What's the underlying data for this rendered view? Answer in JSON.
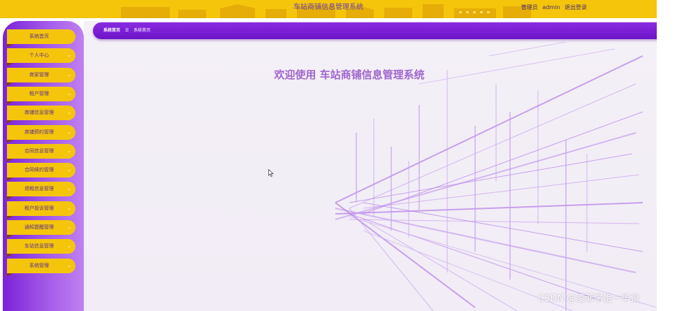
{
  "header": {
    "title": "车站商铺信息管理系统",
    "role": "管理员",
    "username": "admin",
    "logout_label": "退出登录"
  },
  "sidebar": {
    "items": [
      {
        "label": "系统首页",
        "has_submenu": false
      },
      {
        "label": "个人中心",
        "has_submenu": true
      },
      {
        "label": "商家管理",
        "has_submenu": true
      },
      {
        "label": "租户管理",
        "has_submenu": true
      },
      {
        "label": "商铺信息管理",
        "has_submenu": true
      },
      {
        "label": "商铺预约管理",
        "has_submenu": true
      },
      {
        "label": "合同信息管理",
        "has_submenu": true
      },
      {
        "label": "合同续约管理",
        "has_submenu": true
      },
      {
        "label": "退租信息管理",
        "has_submenu": true
      },
      {
        "label": "租户投诉管理",
        "has_submenu": true
      },
      {
        "label": "通知提醒管理",
        "has_submenu": true
      },
      {
        "label": "车站信息管理",
        "has_submenu": true
      },
      {
        "label": "系统管理",
        "has_submenu": true
      }
    ]
  },
  "breadcrumb": {
    "home": "系统首页",
    "separator": "☰",
    "current": "系统首页"
  },
  "main": {
    "welcome": "欢迎使用 车站商铺信息管理系统"
  },
  "watermark": "CSDN @凌菲学姐一毕设",
  "colors": {
    "accent_yellow": "#f5c50c",
    "sidebar_purple": "#7b22d8",
    "welcome_text": "#a066cf"
  }
}
